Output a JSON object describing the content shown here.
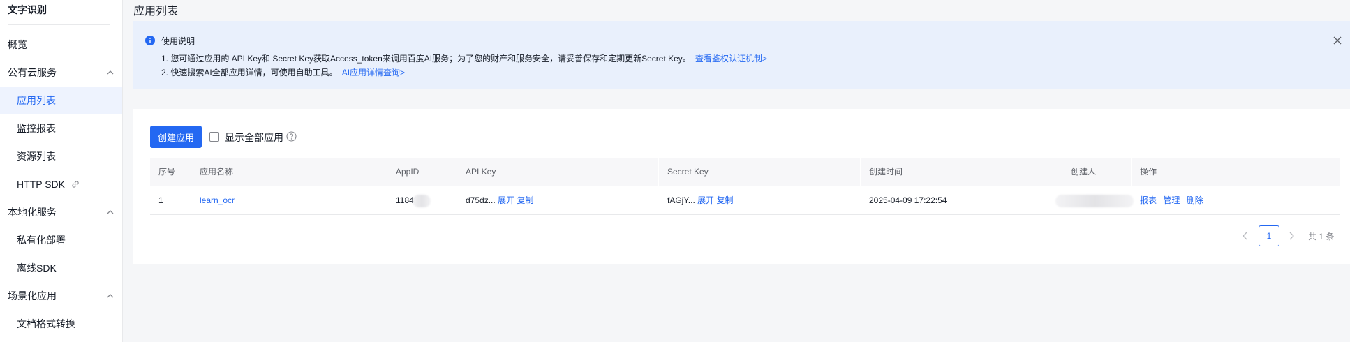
{
  "sidebar": {
    "title": "文字识别",
    "overview": "概览",
    "groups": [
      {
        "label": "公有云服务",
        "items": [
          "应用列表",
          "监控报表",
          "资源列表",
          "HTTP SDK"
        ]
      },
      {
        "label": "本地化服务",
        "items": [
          "私有化部署",
          "离线SDK"
        ]
      },
      {
        "label": "场景化应用",
        "items": [
          "文档格式转换"
        ]
      }
    ],
    "active_item": "应用列表"
  },
  "page_title": "应用列表",
  "notice": {
    "title": "使用说明",
    "line1": "1. 您可通过应用的 API Key和 Secret Key获取Access_token来调用百度AI服务；为了您的财产和服务安全，请妥善保存和定期更新Secret Key。",
    "line1_link": "查看鉴权认证机制>",
    "line2": "2. 快速搜索AI全部应用详情，可使用自助工具。",
    "line2_link": "AI应用详情查询>"
  },
  "toolbar": {
    "create_label": "创建应用",
    "show_all_label": "显示全部应用"
  },
  "table": {
    "columns": [
      "序号",
      "应用名称",
      "AppID",
      "API Key",
      "Secret Key",
      "创建时间",
      "创建人",
      "操作"
    ],
    "rows": [
      {
        "index": "1",
        "name": "learn_ocr",
        "appid": "11842",
        "api_key": "d75dz...",
        "secret_key": "fAGjY...",
        "expand_label": "展开",
        "copy_label": "复制",
        "created_at": "2025-04-09 17:22:54",
        "actions": [
          "报表",
          "管理",
          "删除"
        ]
      }
    ]
  },
  "pagination": {
    "current_page": "1",
    "total": "共 1 条"
  },
  "colors": {
    "accent": "#2468f2",
    "notice_bg": "#e9f0fc",
    "active_bg": "#eef3fe"
  }
}
